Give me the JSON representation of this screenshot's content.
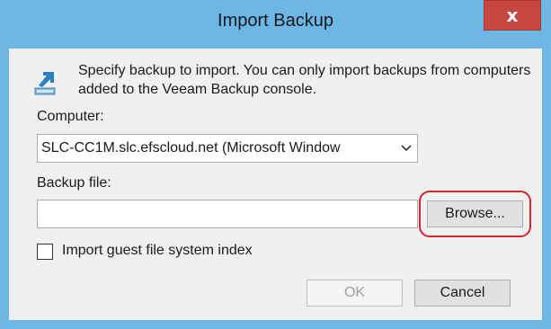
{
  "window": {
    "title": "Import Backup",
    "close_label": "x"
  },
  "info": {
    "icon": "import-arrow-icon",
    "text": "Specify backup to import. You can only import backups from computers added to the Veeam Backup console."
  },
  "computer": {
    "label": "Computer:",
    "selected": "SLC-CC1M.slc.efscloud.net (Microsoft Window"
  },
  "backup_file": {
    "label": "Backup file:",
    "value": "",
    "browse_label": "Browse..."
  },
  "guest_index": {
    "label": "Import guest file system index",
    "checked": false
  },
  "buttons": {
    "ok_label": "OK",
    "ok_enabled": false,
    "cancel_label": "Cancel"
  },
  "colors": {
    "titlebar": "#6db6e6",
    "close": "#c7463e",
    "highlight": "#d9232e"
  }
}
